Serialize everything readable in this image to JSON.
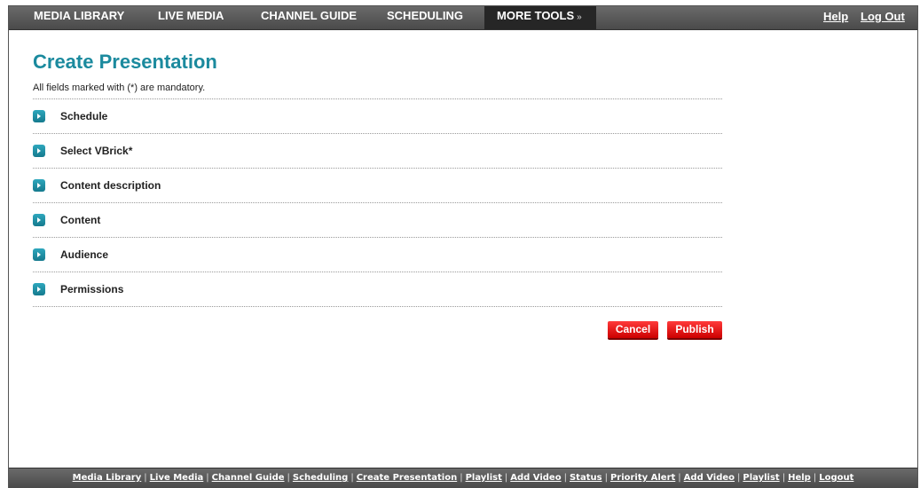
{
  "nav": {
    "items": [
      {
        "label": "MEDIA LIBRARY"
      },
      {
        "label": "LIVE MEDIA"
      },
      {
        "label": "CHANNEL GUIDE"
      },
      {
        "label": "SCHEDULING"
      },
      {
        "label": "MORE TOOLS"
      }
    ],
    "more_tools_chevron": "»",
    "help": "Help",
    "logout": "Log Out"
  },
  "page": {
    "title": "Create Presentation",
    "mandatory_note": "All fields marked with (*) are mandatory."
  },
  "sections": [
    {
      "label": "Schedule",
      "icon": "expand-arrow-icon"
    },
    {
      "label": "Select VBrick*",
      "icon": "expand-arrow-icon"
    },
    {
      "label": "Content description",
      "icon": "expand-arrow-icon"
    },
    {
      "label": "Content",
      "icon": "expand-arrow-icon"
    },
    {
      "label": "Audience",
      "icon": "expand-arrow-icon"
    },
    {
      "label": "Permissions",
      "icon": "expand-arrow-icon"
    }
  ],
  "actions": {
    "cancel": "Cancel",
    "publish": "Publish"
  },
  "footer": {
    "links": [
      "Media Library",
      "Live Media",
      "Channel Guide",
      "Scheduling",
      "Create Presentation",
      "Playlist",
      "Add Video",
      "Status",
      "Priority Alert",
      "Add Video",
      "Playlist",
      "Help",
      "Logout"
    ],
    "separator": "|"
  },
  "colors": {
    "title": "#1b8a9e",
    "nav_bg": "#555555",
    "nav_active": "#262626",
    "button_red": "#e60000",
    "section_icon": "#1f8fa5"
  }
}
